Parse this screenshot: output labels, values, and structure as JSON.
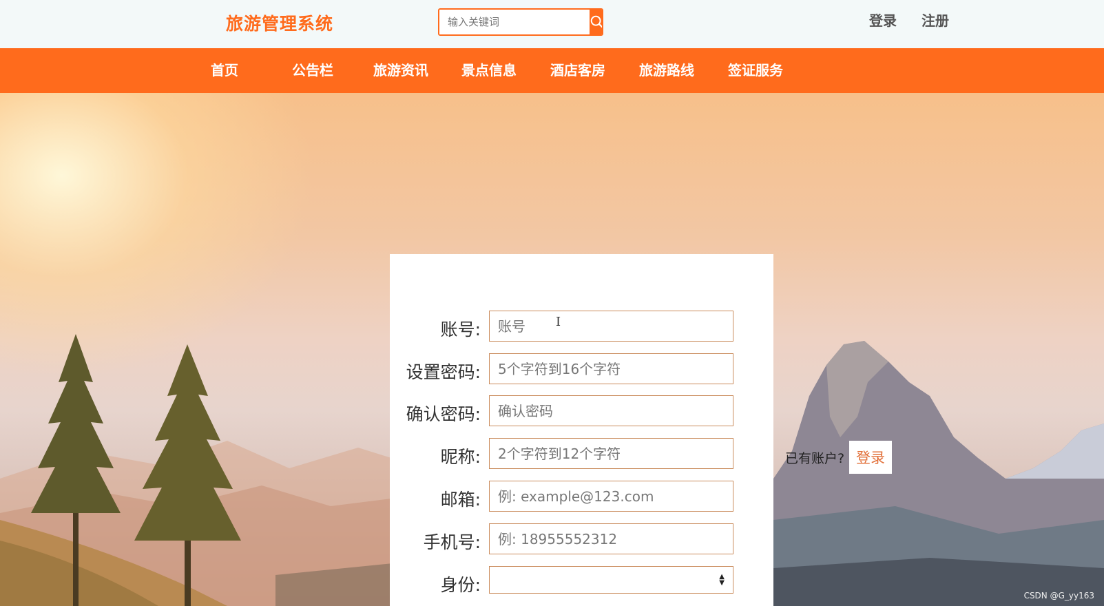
{
  "header": {
    "brand": "旅游管理系统",
    "search_placeholder": "输入关键词",
    "login": "登录",
    "register": "注册"
  },
  "nav": {
    "items": [
      "首页",
      "公告栏",
      "旅游资讯",
      "景点信息",
      "酒店客房",
      "旅游路线",
      "签证服务"
    ]
  },
  "form": {
    "account": {
      "label": "账号:",
      "placeholder": "账号"
    },
    "password": {
      "label": "设置密码:",
      "placeholder": "5个字符到16个字符"
    },
    "confirm": {
      "label": "确认密码:",
      "placeholder": "确认密码"
    },
    "nickname": {
      "label": "昵称:",
      "placeholder": "2个字符到12个字符"
    },
    "email": {
      "label": "邮箱:",
      "placeholder": "例: example@123.com"
    },
    "phone": {
      "label": "手机号:",
      "placeholder": "例: 18955552312"
    },
    "identity": {
      "label": "身份:",
      "value": ""
    }
  },
  "aside": {
    "have_account": "已有账户?",
    "login": "登录"
  },
  "watermark": "CSDN @G_yy163",
  "colors": {
    "accent": "#ff6b1c",
    "field_border": "#c98a5a"
  },
  "icons": {
    "search": "search-icon"
  }
}
